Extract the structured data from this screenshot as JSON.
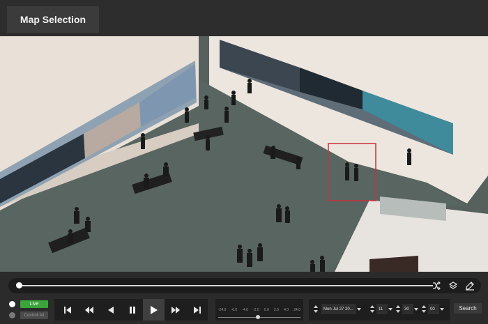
{
  "header": {
    "tab_label": "Map Selection"
  },
  "timeline": {
    "icons": [
      "shuffle-icon",
      "layers-icon",
      "edit-icon"
    ]
  },
  "controls": {
    "live_label": "Live",
    "control_all_label": "Controll All",
    "player_icons": [
      "skip-start-icon",
      "rewind-icon",
      "step-back-icon",
      "pause-icon",
      "play-icon",
      "fast-forward-icon",
      "skip-end-icon"
    ],
    "active_player_icon": "play-icon",
    "speed_labels": [
      "-24.0",
      "-6.0",
      "-4.0",
      "-2.0",
      "0.0",
      "2.0",
      "4.0",
      "24.0"
    ],
    "date_value": "Mon Jul 27 20...",
    "hour_value": "11",
    "minute_value": "30",
    "second_value": "00",
    "search_label": "Search"
  },
  "colors": {
    "live_green": "#3aa53a",
    "selection_box": "#c8323c",
    "panel_dark": "#1e1e1e"
  }
}
